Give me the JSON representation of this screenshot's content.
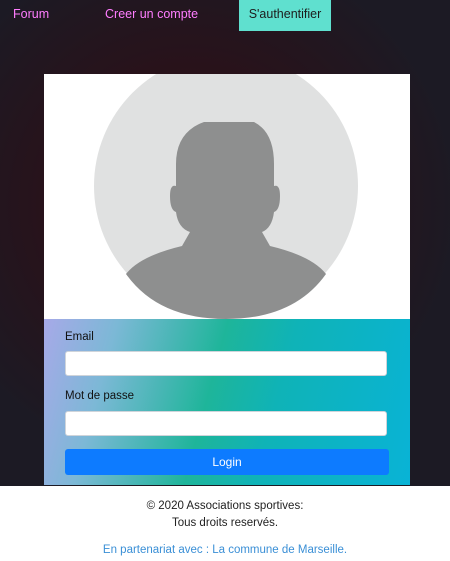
{
  "nav": {
    "forum": "Forum",
    "register": "Creer un compte",
    "login": "S'authentifier"
  },
  "avatar": {
    "icon": "user-silhouette-icon"
  },
  "form": {
    "email_label": "Email",
    "email_value": "",
    "password_label": "Mot de passe",
    "password_value": "",
    "submit_label": "Login"
  },
  "footer": {
    "copyright": "© 2020 Associations sportives:",
    "rights": "Tous droits reservés.",
    "partner": "En partenariat avec : La commune de Marseille."
  },
  "colors": {
    "nav_link": "#ff7dff",
    "nav_active_bg": "#5fe0cf",
    "button_primary": "#0d7bff",
    "footer_link": "#3a8fd6"
  }
}
